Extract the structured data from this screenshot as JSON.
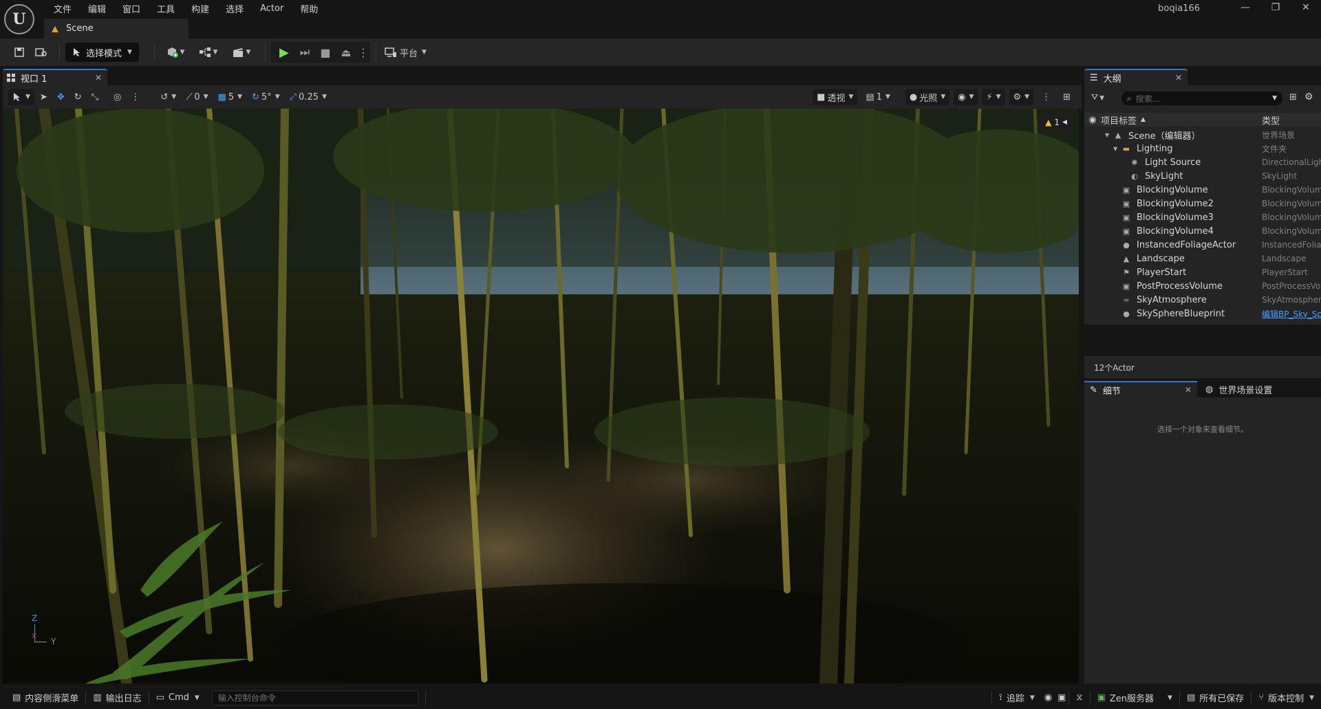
{
  "app": {
    "menu": [
      "文件",
      "编辑",
      "窗口",
      "工具",
      "构建",
      "选择",
      "Actor",
      "帮助"
    ],
    "doc_tab": "Scene",
    "username": "boqia166",
    "window_controls": [
      "—",
      "❐",
      "✕"
    ]
  },
  "toolbar": {
    "mode_label": "选择模式",
    "platform_label": "平台"
  },
  "viewport": {
    "tab_label": "视口 1",
    "snap_angle": "0",
    "grid_snap": "5",
    "rot_snap": "5°",
    "scale_snap": "0.25",
    "view_mode": "透视",
    "cam_speed": "1",
    "lit_mode": "光照",
    "warning_count": "1",
    "axis_z": "Z",
    "axis_x": "X",
    "axis_y": "Y"
  },
  "outliner": {
    "tab_label": "大纲",
    "search_placeholder": "搜索...",
    "col_label": "项目标签",
    "col_type": "类型",
    "rows": [
      {
        "label": "Scene（编辑器）",
        "type": "世界场景",
        "icon": "world-icon",
        "indent": 0,
        "arrow": "▼"
      },
      {
        "label": "Lighting",
        "type": "文件夹",
        "icon": "folder-icon",
        "indent": 1,
        "arrow": "▼"
      },
      {
        "label": "Light Source",
        "type": "DirectionalLight",
        "icon": "sun-icon",
        "indent": 2,
        "arrow": ""
      },
      {
        "label": "SkyLight",
        "type": "SkyLight",
        "icon": "skylight-icon",
        "indent": 2,
        "arrow": ""
      },
      {
        "label": "BlockingVolume",
        "type": "BlockingVolume",
        "icon": "volume-icon",
        "indent": 1,
        "arrow": ""
      },
      {
        "label": "BlockingVolume2",
        "type": "BlockingVolume",
        "icon": "volume-icon",
        "indent": 1,
        "arrow": ""
      },
      {
        "label": "BlockingVolume3",
        "type": "BlockingVolume",
        "icon": "volume-icon",
        "indent": 1,
        "arrow": ""
      },
      {
        "label": "BlockingVolume4",
        "type": "BlockingVolume",
        "icon": "volume-icon",
        "indent": 1,
        "arrow": ""
      },
      {
        "label": "InstancedFoliageActor",
        "type": "InstancedFoliageActor",
        "icon": "actor-icon",
        "indent": 1,
        "arrow": ""
      },
      {
        "label": "Landscape",
        "type": "Landscape",
        "icon": "landscape-icon",
        "indent": 1,
        "arrow": ""
      },
      {
        "label": "PlayerStart",
        "type": "PlayerStart",
        "icon": "playerstart-icon",
        "indent": 1,
        "arrow": ""
      },
      {
        "label": "PostProcessVolume",
        "type": "PostProcessVolume",
        "icon": "volume-icon",
        "indent": 1,
        "arrow": ""
      },
      {
        "label": "SkyAtmosphere",
        "type": "SkyAtmosphere",
        "icon": "atmosphere-icon",
        "indent": 1,
        "arrow": ""
      },
      {
        "label": "SkySphereBlueprint",
        "type": "编辑BP_Sky_Sphere",
        "icon": "actor-icon",
        "indent": 1,
        "arrow": "",
        "link": true
      }
    ],
    "count": "12个Actor"
  },
  "details": {
    "tab_label": "细节",
    "world_tab_label": "世界场景设置",
    "empty_text": "选择一个对象来查看细节。"
  },
  "statusbar": {
    "content_drawer": "内容侧滑菜单",
    "output_log": "输出日志",
    "cmd_label": "Cmd",
    "cmd_placeholder": "输入控制台命令",
    "trace": "追踪",
    "zen": "Zen服务器",
    "saved": "所有已保存",
    "revision": "版本控制"
  }
}
